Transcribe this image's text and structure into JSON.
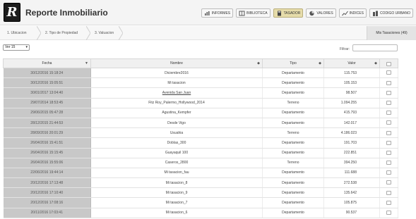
{
  "header": {
    "logo_letter": "R",
    "title": "Reporte Inmobiliario",
    "nav": [
      {
        "label": "INFORMES",
        "icon": "chart-icon"
      },
      {
        "label": "BIBLIOTECA",
        "icon": "book-icon"
      },
      {
        "label": "TASADOR",
        "icon": "calculator-icon"
      },
      {
        "label": "VALORES",
        "icon": "pie-chart-icon"
      },
      {
        "label": "INDICES",
        "icon": "line-chart-icon"
      },
      {
        "label": "CODIGO URBANO",
        "icon": "building-icon"
      }
    ],
    "active_nav": "TASADOR",
    "active_color": "#e6dcaa"
  },
  "steps": {
    "items": [
      "1. Ubicacion",
      "2. Tipo de Propiedad",
      "3. Valuacion"
    ],
    "tasaciones_label": "Mis Tasaciones (49)"
  },
  "controls": {
    "page_size": "Ver 15",
    "filter_label": "Filtrar:",
    "filter_value": ""
  },
  "table": {
    "columns": [
      "Fecha",
      "Nombre",
      "Tipo",
      "Valor"
    ],
    "rows": [
      {
        "fecha": "30/12/2016 15:18:24",
        "nombre": "Diciembre2016",
        "tipo": "Departamento",
        "valor": "115.753"
      },
      {
        "fecha": "30/12/2016 15:05:51",
        "nombre": "Mi tasacion",
        "tipo": "Departamento",
        "valor": "105.153"
      },
      {
        "fecha": "30/01/2017 13:04:40",
        "nombre": "Avenida San Juan",
        "tipo": "Departamento",
        "valor": "98.507"
      },
      {
        "fecha": "29/07/2014 18:53:45",
        "nombre": "Fitz Roy_Palermo_Hollywood_2014",
        "tipo": "Terreno",
        "valor": "1.094.255"
      },
      {
        "fecha": "29/06/2015 05:47:28",
        "nombre": "Agustina_Kempfer",
        "tipo": "Departamento",
        "valor": "415.793"
      },
      {
        "fecha": "28/12/2015 21:44:53",
        "nombre": "Desde Vigo",
        "tipo": "Departamento",
        "valor": "142.017"
      },
      {
        "fecha": "28/09/2016 20:01:29",
        "nombre": "Usuahia",
        "tipo": "Terreno",
        "valor": "4.186.023"
      },
      {
        "fecha": "26/04/2016 15:41:51",
        "nombre": "Doblas_300",
        "tipo": "Departamento",
        "valor": "191.703"
      },
      {
        "fecha": "26/04/2016 15:15:45",
        "nombre": "Guayaquil 100",
        "tipo": "Departamento",
        "valor": "222.851"
      },
      {
        "fecha": "26/04/2016 15:55:06",
        "nombre": "Caseros_2800",
        "tipo": "Terreno",
        "valor": "394.250"
      },
      {
        "fecha": "22/06/2016 19:44:14",
        "nombre": "Mi tasacion_fau",
        "tipo": "Departamento",
        "valor": "111.688"
      },
      {
        "fecha": "20/12/2016 17:13:48",
        "nombre": "Mi tasacion_8",
        "tipo": "Departamento",
        "valor": "272.538"
      },
      {
        "fecha": "20/12/2016 17:10:40",
        "nombre": "Mi tasacion_9",
        "tipo": "Departamento",
        "valor": "135.642"
      },
      {
        "fecha": "20/12/2016 17:08:16",
        "nombre": "Mi tasacion_7",
        "tipo": "Departamento",
        "valor": "105.875"
      },
      {
        "fecha": "20/11/2016 17:03:41",
        "nombre": "Mi tasacion_6",
        "tipo": "Departamento",
        "valor": "90.537"
      }
    ],
    "linked_row": 2
  }
}
